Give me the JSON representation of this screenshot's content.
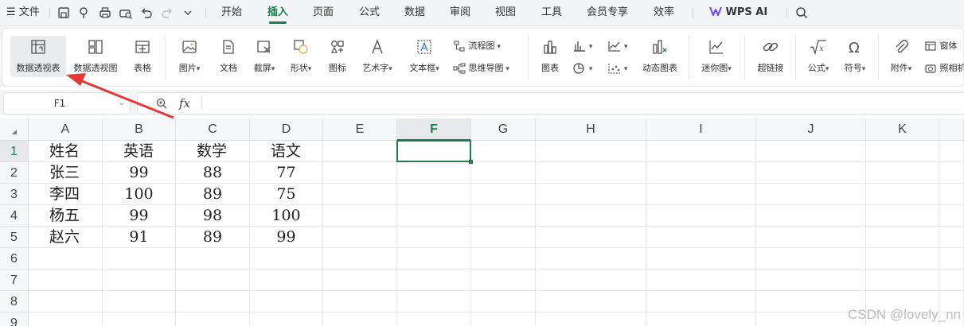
{
  "titlebar": {
    "menu_icon": "hamburger-icon",
    "file_label": "文件",
    "quick_icons": [
      "save-icon",
      "cloud-icon",
      "print-icon",
      "print-preview-icon",
      "undo-icon",
      "redo-icon",
      "more-icon"
    ],
    "tabs": [
      "开始",
      "插入",
      "页面",
      "公式",
      "数据",
      "审阅",
      "视图",
      "工具",
      "会员专享",
      "效率"
    ],
    "active_tab": "插入",
    "wps_ai": "WPS AI",
    "search_icon": "search-icon"
  },
  "ribbon": {
    "pivot_table": "数据透视表",
    "pivot_chart": "数据透视图",
    "table": "表格",
    "picture": "图片",
    "document": "文档",
    "screenshot": "截屏",
    "shape": "形状",
    "icon": "图标",
    "wordart": "艺术字",
    "textbox": "文本框",
    "flowchart": "流程图",
    "mindmap": "思维导图",
    "chart": "图表",
    "dynamic_chart": "动态图表",
    "sparkline": "迷你图",
    "hyperlink": "超链接",
    "formula": "公式",
    "symbol": "符号",
    "attachment": "附件",
    "window": "窗体",
    "camera": "照相机"
  },
  "formula_bar": {
    "name_box": "F1",
    "fx_label": "fx",
    "content": ""
  },
  "sheet": {
    "columns": [
      "A",
      "B",
      "C",
      "D",
      "E",
      "F",
      "G",
      "H",
      "I",
      "J",
      "K"
    ],
    "selected_column": "F",
    "row_numbers": [
      "1",
      "2",
      "3",
      "4",
      "5",
      "6",
      "7",
      "8",
      "9"
    ],
    "selected_row": "1",
    "rows": [
      [
        "姓名",
        "英语",
        "数学",
        "语文"
      ],
      [
        "张三",
        "99",
        "88",
        "77"
      ],
      [
        "李四",
        "100",
        "89",
        "75"
      ],
      [
        "杨五",
        "99",
        "98",
        "100"
      ],
      [
        "赵六",
        "91",
        "89",
        "99"
      ]
    ],
    "selected_cell": "F1"
  },
  "watermark": "CSDN @lovely_nn",
  "colors": {
    "accent": "#1a7f4b",
    "arrow": "#e53935"
  }
}
